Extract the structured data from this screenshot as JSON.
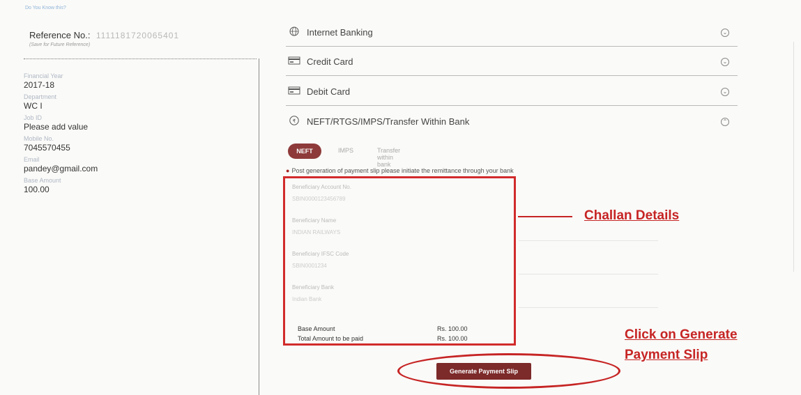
{
  "breadcrumb": "Do You Know this?",
  "reference": {
    "label": "Reference No.:",
    "value": "1111181720065401",
    "note": "(Save for Future Reference)"
  },
  "details": [
    {
      "label": "Financial Year",
      "value": "2017-18"
    },
    {
      "label": "Department",
      "value": "WC I"
    },
    {
      "label": "Job ID",
      "value": "Please add value"
    },
    {
      "label": "Mobile No.",
      "value": "7045570455"
    },
    {
      "label": "Email",
      "value": "pandey@gmail.com"
    },
    {
      "label": "Base Amount",
      "value": "100.00"
    }
  ],
  "payment_methods": [
    {
      "label": "Internet Banking",
      "icon": "globe-icon"
    },
    {
      "label": "Credit Card",
      "icon": "credit-card-icon"
    },
    {
      "label": "Debit Card",
      "icon": "debit-card-icon"
    },
    {
      "label": "NEFT/RTGS/IMPS/Transfer Within Bank",
      "icon": "bank-transfer-icon"
    }
  ],
  "tabs": {
    "active": "NEFT",
    "others": [
      "IMPS",
      "Transfer within bank"
    ]
  },
  "info_text": "Post generation of payment slip please initiate the remittance through your bank",
  "challan": {
    "fields": [
      {
        "label": "Beneficiary Account No.",
        "value": "SBIN0000123456789"
      },
      {
        "label": "Beneficiary Name",
        "value": "INDIAN RAILWAYS"
      },
      {
        "label": "Beneficiary IFSC Code",
        "value": "SBIN0001234"
      },
      {
        "label": "Beneficiary Bank",
        "value": "Indian Bank"
      }
    ],
    "base_amount_label": "Base Amount",
    "base_amount_value": "Rs. 100.00",
    "total_label": "Total Amount to be paid",
    "total_value": "Rs. 100.00"
  },
  "generate_button": "Generate Payment Slip",
  "annotations": {
    "challan": "Challan Details",
    "click_line1": "Click on Generate",
    "click_line2": "Payment Slip",
    "color": "#c62424"
  },
  "colors": {
    "accent": "#8e3a3a",
    "highlight": "#d12b2b"
  }
}
